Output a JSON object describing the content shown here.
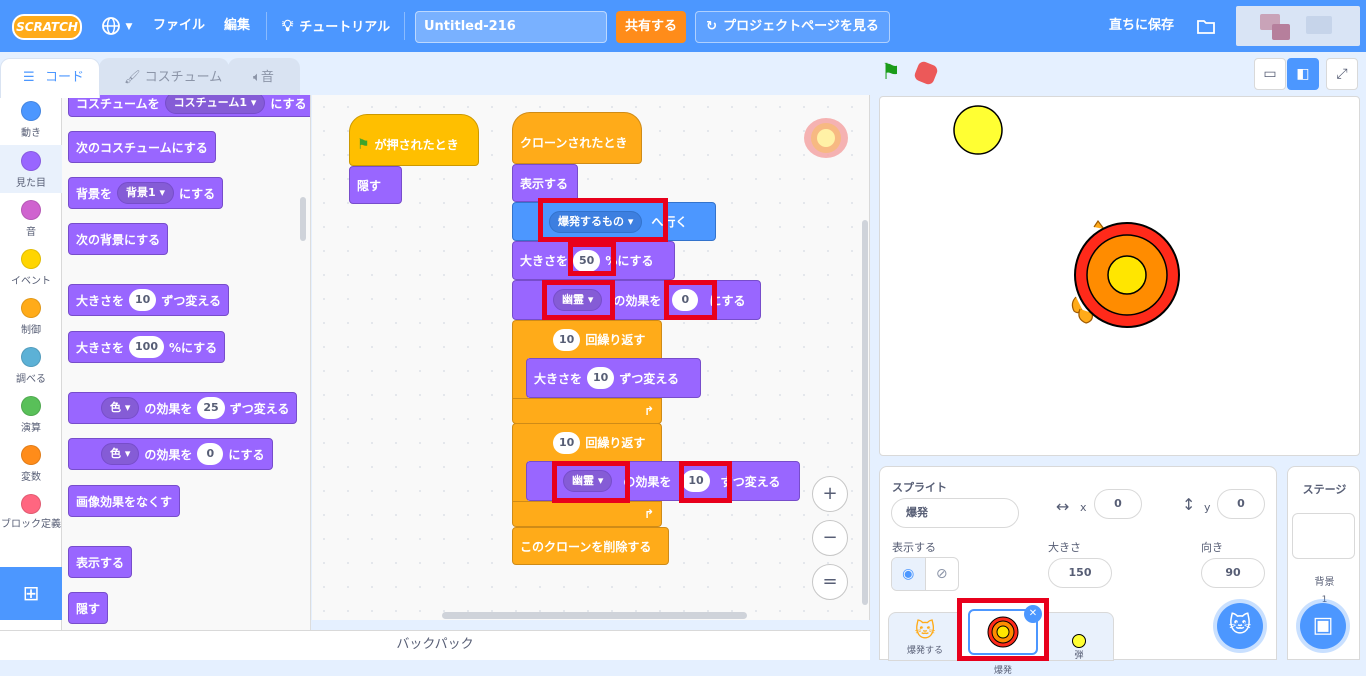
{
  "menubar": {
    "logo": "SCRATCH",
    "file": "ファイル",
    "edit": "編集",
    "tutorial": "チュートリアル",
    "project_title": "Untitled-216",
    "share": "共有する",
    "see_page": "プロジェクトページを見る",
    "save_now": "直ちに保存"
  },
  "tabs": {
    "code": "コード",
    "costume": "コスチューム",
    "sound": "音"
  },
  "categories": [
    {
      "label": "動き",
      "color": "#4c97ff"
    },
    {
      "label": "見た目",
      "color": "#9966ff"
    },
    {
      "label": "音",
      "color": "#cf63cf"
    },
    {
      "label": "イベント",
      "color": "#ffd500"
    },
    {
      "label": "制御",
      "color": "#ffab19"
    },
    {
      "label": "調べる",
      "color": "#5cb1d6"
    },
    {
      "label": "演算",
      "color": "#59c059"
    },
    {
      "label": "変数",
      "color": "#ff8c1a"
    },
    {
      "label": "ブロック定義",
      "color": "#ff6680"
    }
  ],
  "flyout": {
    "b1_pre": "コスチュームを",
    "b1_dd": "コスチューム1",
    "b1_post": "にする",
    "b2": "次のコスチュームにする",
    "b3_pre": "背景を",
    "b3_dd": "背景1",
    "b3_post": "にする",
    "b4": "次の背景にする",
    "b5_pre": "大きさを",
    "b5_num": "10",
    "b5_post": "ずつ変える",
    "b6_pre": "大きさを",
    "b6_num": "100",
    "b6_post": "%にする",
    "b7_dd": "色",
    "b7_mid": "の効果を",
    "b7_num": "25",
    "b7_post": "ずつ変える",
    "b8_dd": "色",
    "b8_mid": "の効果を",
    "b8_num": "0",
    "b8_post": "にする",
    "b9": "画像効果をなくす",
    "b10": "表示する",
    "b11": "隠す"
  },
  "script1": {
    "hat": "が押されたとき",
    "hide": "隠す"
  },
  "script2": {
    "hat": "クローンされたとき",
    "show": "表示する",
    "goto_dd": "爆発するもの",
    "goto_post": "へ行く",
    "size_pre": "大きさを",
    "size_num": "50",
    "size_post": "%にする",
    "eff_dd": "幽霊",
    "eff_mid": "の効果を",
    "eff_num": "0",
    "eff_post": "にする",
    "rep1_num": "10",
    "rep1_label": "回繰り返す",
    "chg_pre": "大きさを",
    "chg_num": "10",
    "chg_post": "ずつ変える",
    "rep2_num": "10",
    "rep2_label": "回繰り返す",
    "chg2_dd": "幽霊",
    "chg2_mid": "の効果を",
    "chg2_num": "10",
    "chg2_post": "ずつ変える",
    "delete": "このクローンを削除する"
  },
  "zoom": {
    "in": "+",
    "out": "−",
    "reset": "="
  },
  "backpack": "バックパック",
  "sprite_info": {
    "sprite_label": "スプライト",
    "sprite_name": "爆発",
    "x_label": "x",
    "x_value": "0",
    "y_label": "y",
    "y_value": "0",
    "show_label": "表示する",
    "size_label": "大きさ",
    "size_value": "150",
    "direction_label": "向き",
    "direction_value": "90"
  },
  "sprites": [
    {
      "name": "爆発する"
    },
    {
      "name": "爆発"
    },
    {
      "name": "弾"
    }
  ],
  "stage_panel": {
    "title": "ステージ",
    "backdrop_label": "背景",
    "backdrop_count": "1"
  }
}
